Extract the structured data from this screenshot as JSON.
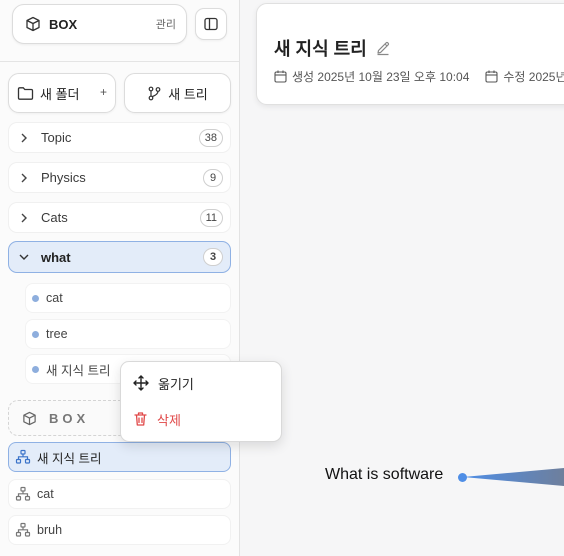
{
  "sidebar": {
    "box_title": "BOX",
    "manage_label": "관리",
    "new_folder_label": "새 폴더",
    "new_folder_plus": "+",
    "new_tree_label": "새 트리",
    "folders": [
      {
        "name": "Topic",
        "count": "38"
      },
      {
        "name": "Physics",
        "count": "9"
      },
      {
        "name": "Cats",
        "count": "11"
      },
      {
        "name": "what",
        "count": "3"
      }
    ],
    "what_children": [
      {
        "name": "cat"
      },
      {
        "name": "tree"
      },
      {
        "name": "새 지식 트리"
      }
    ],
    "box_section_label": "BOX",
    "trees": [
      {
        "name": "새 지식 트리"
      },
      {
        "name": "cat"
      },
      {
        "name": "bruh"
      }
    ]
  },
  "context_menu": {
    "move_label": "옮기기",
    "delete_label": "삭제"
  },
  "main": {
    "title": "새 지식 트리",
    "created": "생성 2025년 10월 23일 오후 10:04",
    "modified": "수정 2025년"
  },
  "canvas": {
    "node_label": "What is software"
  },
  "colors": {
    "accent_blue": "#4f8ee6",
    "active_bg": "#e3ecf9",
    "active_border": "#8fb1e4",
    "delete_red": "#e04848"
  }
}
